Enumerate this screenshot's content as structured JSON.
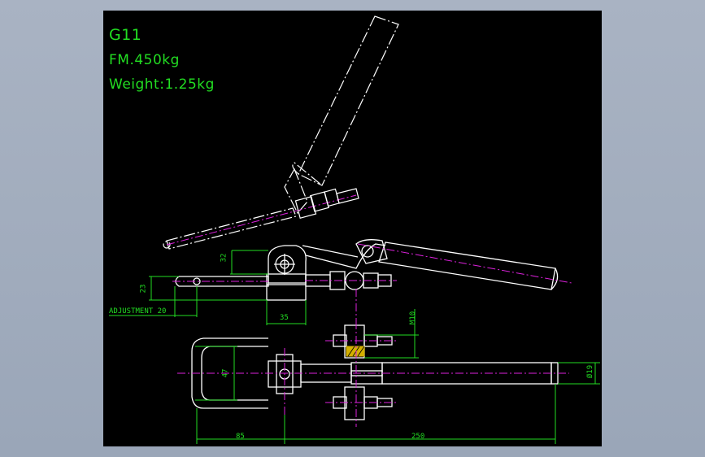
{
  "title_block": {
    "model": "G11",
    "force": "FM.450kg",
    "weight": "Weight:1.25kg"
  },
  "dimensions": {
    "height_32": "32",
    "height_23": "23",
    "adjustment": "ADJUSTMENT 20",
    "base_35": "35",
    "thread_m10": "M10",
    "width_47": "47",
    "diameter_19": "Ø19",
    "length_85": "85",
    "length_250": "250"
  },
  "colors": {
    "background": "#000000",
    "outline": "#ffffff",
    "dimension": "#22dd22",
    "centerline": "#dd22dd",
    "hatch": "#d4b000",
    "frame": "#a9b3c3"
  }
}
